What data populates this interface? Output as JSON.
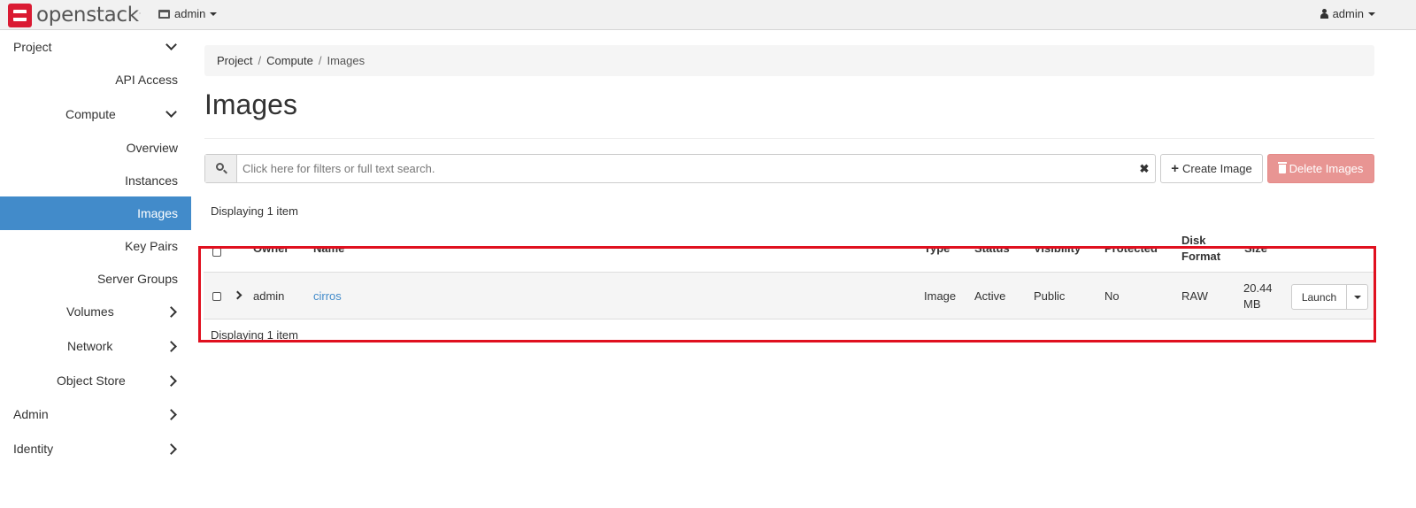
{
  "brand": {
    "name": "openstack",
    "tm": "."
  },
  "topbar": {
    "project": "admin",
    "user": "admin"
  },
  "sidebar": {
    "items": [
      {
        "label": "Project"
      },
      {
        "label": "API Access"
      },
      {
        "label": "Compute"
      },
      {
        "label": "Overview"
      },
      {
        "label": "Instances"
      },
      {
        "label": "Images"
      },
      {
        "label": "Key Pairs"
      },
      {
        "label": "Server Groups"
      },
      {
        "label": "Volumes"
      },
      {
        "label": "Network"
      },
      {
        "label": "Object Store"
      },
      {
        "label": "Admin"
      },
      {
        "label": "Identity"
      }
    ]
  },
  "breadcrumb": {
    "project": "Project",
    "compute": "Compute",
    "current": "Images",
    "sep": "/"
  },
  "page": {
    "title": "Images"
  },
  "search": {
    "placeholder": "Click here for filters or full text search.",
    "clear": "✖"
  },
  "actions": {
    "create": "Create Image",
    "create_icon": "+",
    "delete": "Delete Images"
  },
  "table": {
    "count_top": "Displaying 1 item",
    "count_bottom": "Displaying 1 item",
    "columns": {
      "owner": "Owner",
      "name": "Name",
      "type": "Type",
      "status": "Status",
      "visibility": "Visibility",
      "protected": "Protected",
      "disk_format_1": "Disk",
      "disk_format_2": "Format",
      "size": "Size"
    },
    "rows": [
      {
        "owner": "admin",
        "name": "cirros",
        "type": "Image",
        "status": "Active",
        "visibility": "Public",
        "protected": "No",
        "disk_format": "RAW",
        "size_1": "20.44",
        "size_2": "MB",
        "action": "Launch"
      }
    ]
  },
  "colors": {
    "accent": "#428bca",
    "brand": "#da1a32",
    "danger": "#e89593",
    "highlight": "#e0101f"
  }
}
